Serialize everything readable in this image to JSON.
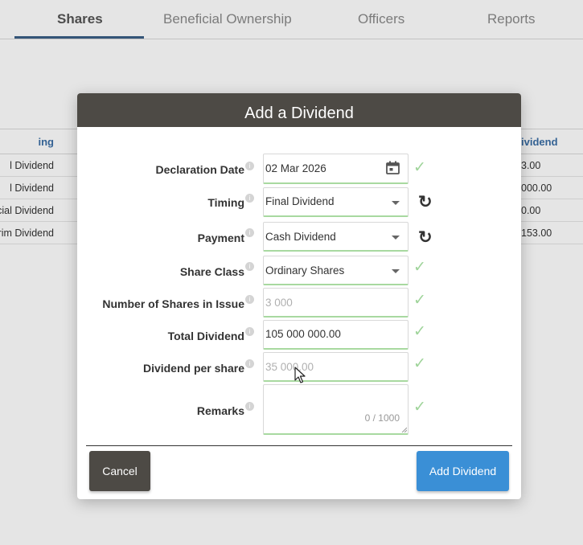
{
  "tabs": [
    {
      "label": "Shares",
      "active": true
    },
    {
      "label": "Beneficial Ownership",
      "active": false
    },
    {
      "label": "Officers",
      "active": false
    },
    {
      "label": "Reports",
      "active": false
    }
  ],
  "background_table": {
    "left_header": "ing",
    "left_rows": [
      "l Dividend",
      "l Dividend",
      "cial Dividend",
      "rim Dividend"
    ],
    "right_header": "ividend",
    "right_rows": [
      "3.00",
      "000.00",
      "0.00",
      "153.00"
    ]
  },
  "modal": {
    "title": "Add a Dividend",
    "fields": {
      "declaration_date": {
        "label": "Declaration Date",
        "value": "02 Mar 2026"
      },
      "timing": {
        "label": "Timing",
        "value": "Final Dividend"
      },
      "payment": {
        "label": "Payment",
        "value": "Cash Dividend"
      },
      "share_class": {
        "label": "Share Class",
        "value": "Ordinary Shares"
      },
      "shares_in_issue": {
        "label": "Number of Shares in Issue",
        "value": "3 000"
      },
      "total_dividend": {
        "label": "Total Dividend",
        "value": "105 000 000.00"
      },
      "dividend_per_share": {
        "label": "Dividend per share",
        "value": "35 000.00"
      },
      "remarks": {
        "label": "Remarks",
        "value": "",
        "counter": "0 / 1000"
      }
    },
    "buttons": {
      "cancel": "Cancel",
      "add": "Add Dividend"
    }
  },
  "icons": {
    "info": "info-icon",
    "check": "checkmark-icon",
    "refresh": "refresh-icon",
    "calendar": "calendar-icon",
    "dropdown": "chevron-down-icon"
  },
  "colors": {
    "header_bg": "#4d4a45",
    "primary_button": "#3a8fd6",
    "valid_green": "#9fd49a",
    "link_blue": "#3a6ea5"
  }
}
